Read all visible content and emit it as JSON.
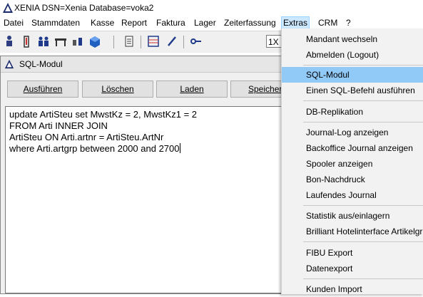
{
  "window": {
    "title": "XENIA  DSN=Xenia  Database=voka2"
  },
  "menubar": {
    "items": [
      {
        "label": "Datei"
      },
      {
        "label": "Stammdaten"
      },
      {
        "label": "Kasse"
      },
      {
        "label": "Report"
      },
      {
        "label": "Faktura"
      },
      {
        "label": "Lager"
      },
      {
        "label": "Zeiterfassung"
      },
      {
        "label": "Extras"
      },
      {
        "label": "CRM"
      },
      {
        "label": "?"
      }
    ],
    "active": "Extras"
  },
  "toolbar": {
    "field_value": "1X",
    "icons": [
      "person-icon",
      "door-icon",
      "group-icon",
      "table-icon",
      "tools-icon",
      "box-icon",
      "list-icon",
      "abacus-icon",
      "pen-icon",
      "key-icon"
    ]
  },
  "sql_window": {
    "title": "SQL-Modul",
    "buttons": {
      "execute": "Ausführen",
      "clear": "Löschen",
      "load": "Laden",
      "save": "Speichern"
    },
    "query_lines": [
      "update ArtiSteu set MwstKz = 2, MwstKz1 = 2",
      "FROM Arti INNER JOIN",
      "ArtiSteu ON Arti.artnr = ArtiSteu.ArtNr",
      "where Arti.artgrp between 2000 and 2700"
    ]
  },
  "extras_menu": {
    "items": [
      "Mandant wechseln",
      "Abmelden (Logout)",
      "SQL-Modul",
      "Einen SQL-Befehl ausführen",
      "DB-Replikation",
      "Journal-Log anzeigen",
      "Backoffice  Journal anzeigen",
      "Spooler anzeigen",
      "Bon-Nachdruck",
      "Laufendes Journal",
      "Statistik aus/einlagern",
      "Brilliant Hotelinterface Artikelgruppen",
      "FIBU Export",
      "Datenexport",
      "Kunden Import"
    ],
    "highlighted": "SQL-Modul"
  },
  "colors": {
    "highlight": "#91c9f7",
    "menu_active": "#cce8ff",
    "menu_bg": "#f2f2f2"
  }
}
